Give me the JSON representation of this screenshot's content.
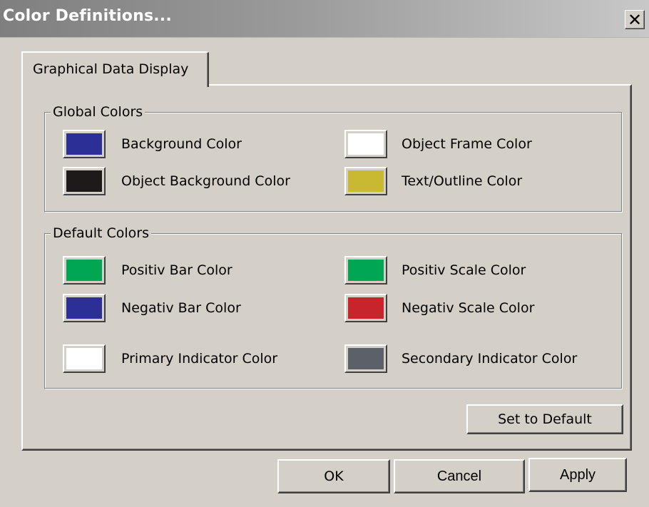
{
  "window": {
    "title": "Color Definitions...",
    "close_glyph": "✕"
  },
  "tabs": [
    {
      "label": "Graphical Data Display",
      "selected": true
    }
  ],
  "global_colors": {
    "legend": "Global Colors",
    "items": [
      {
        "label": "Background Color",
        "color": "#2b2f96"
      },
      {
        "label": "Object Frame Color",
        "color": "#ffffff"
      },
      {
        "label": "Object Background Color",
        "color": "#1e1a1a"
      },
      {
        "label": "Text/Outline Color",
        "color": "#c8b832"
      }
    ]
  },
  "default_colors": {
    "legend": "Default Colors",
    "items": [
      {
        "label": "Positiv Bar Color",
        "color": "#00a651"
      },
      {
        "label": "Positiv Scale Color",
        "color": "#00a651"
      },
      {
        "label": "Negativ Bar Color",
        "color": "#2b2f96"
      },
      {
        "label": "Negativ Scale Color",
        "color": "#c8242c"
      },
      {
        "label": "Primary Indicator Color",
        "color": "#ffffff"
      },
      {
        "label": "Secondary Indicator Color",
        "color": "#5b6166"
      }
    ]
  },
  "buttons": {
    "set_default": "Set to Default",
    "ok": "OK",
    "cancel": "Cancel",
    "apply": "Apply"
  }
}
